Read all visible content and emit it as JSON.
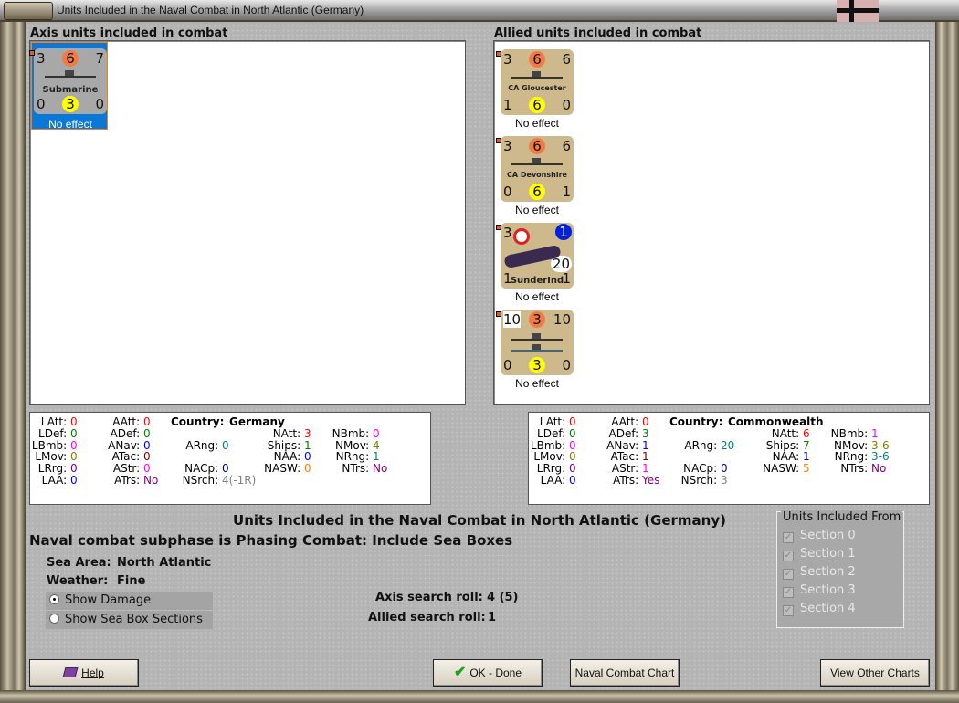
{
  "window": {
    "title": "Units Included in the Naval Combat in North Atlantic (Germany)"
  },
  "axis": {
    "header": "Axis units included in combat",
    "units": [
      {
        "top": "3",
        "mid": "6",
        "right": "7",
        "bl": "0",
        "bm": "3",
        "br": "0",
        "name": "Submarine",
        "effect": "No effect",
        "selected": true
      }
    ]
  },
  "allied": {
    "header": "Allied units included in combat",
    "units": [
      {
        "top": "3",
        "mid": "6",
        "right": "6",
        "bl": "1",
        "bm": "6",
        "br": "0",
        "name": "CA Gloucester",
        "effect": "No effect"
      },
      {
        "top": "3",
        "mid": "6",
        "right": "6",
        "bl": "0",
        "bm": "6",
        "br": "1",
        "name": "CA Devonshire",
        "effect": "No effect"
      },
      {
        "top": "3",
        "mid": "1",
        "right": "20",
        "bl": "1",
        "bm": "",
        "br": "1",
        "name": "SunderInd",
        "effect": "No effect"
      },
      {
        "top": "10",
        "mid": "3",
        "right": "10",
        "bl": "0",
        "bm": "3",
        "br": "0",
        "name": "",
        "effect": "No effect"
      }
    ]
  },
  "axis_stats": {
    "country_label": "Country:",
    "country": "Germany",
    "LAtt": "0",
    "LDef": "0",
    "LBmb": "0",
    "LMov": "0",
    "LRrg": "0",
    "LAA": "0",
    "AAtt": "0",
    "ADef": "0",
    "ANav": "0",
    "ATac": "0",
    "AStr": "0",
    "ATrs": "No",
    "ARng": "0",
    "NACp": "0",
    "NSrch": "4(-1R)",
    "NAtt": "3",
    "Ships": "1",
    "NAA": "0",
    "NASW": "0",
    "NBmb": "0",
    "NMov": "4",
    "NRng": "1",
    "NTrs": "No"
  },
  "allied_stats": {
    "country_label": "Country:",
    "country": "Commonwealth",
    "LAtt": "0",
    "LDef": "0",
    "LBmb": "0",
    "LMov": "0",
    "LRrg": "0",
    "LAA": "0",
    "AAtt": "0",
    "ADef": "3",
    "ANav": "1",
    "ATac": "1",
    "AStr": "1",
    "ATrs": "Yes",
    "ARng": "20",
    "NACp": "0",
    "NSrch": "3",
    "NAtt": "6",
    "Ships": "7",
    "NAA": "1",
    "NASW": "5",
    "NBmb": "1",
    "NMov": "3-6",
    "NRng": "3-6",
    "NTrs": "No"
  },
  "info": {
    "heading": "Units Included in the Naval Combat in North Atlantic (Germany)",
    "subphase": "Naval combat subphase is Phasing Combat: Include Sea Boxes",
    "sea_area_label": "Sea Area:",
    "sea_area": "North Atlantic",
    "weather_label": "Weather:",
    "weather": "Fine",
    "axis_roll_label": "Axis search roll:",
    "axis_roll": "4 (5)",
    "allied_roll_label": "Allied search roll:",
    "allied_roll": "1"
  },
  "options": {
    "show_damage": "Show Damage",
    "show_sections": "Show Sea Box Sections",
    "selected": "show_damage"
  },
  "sections": {
    "legend": "Units Included From",
    "items": [
      "Section 0",
      "Section 1",
      "Section 2",
      "Section 3",
      "Section 4"
    ]
  },
  "buttons": {
    "help": "Help",
    "ok": "OK - Done",
    "naval_chart": "Naval Combat Chart",
    "other_charts": "View Other Charts"
  }
}
